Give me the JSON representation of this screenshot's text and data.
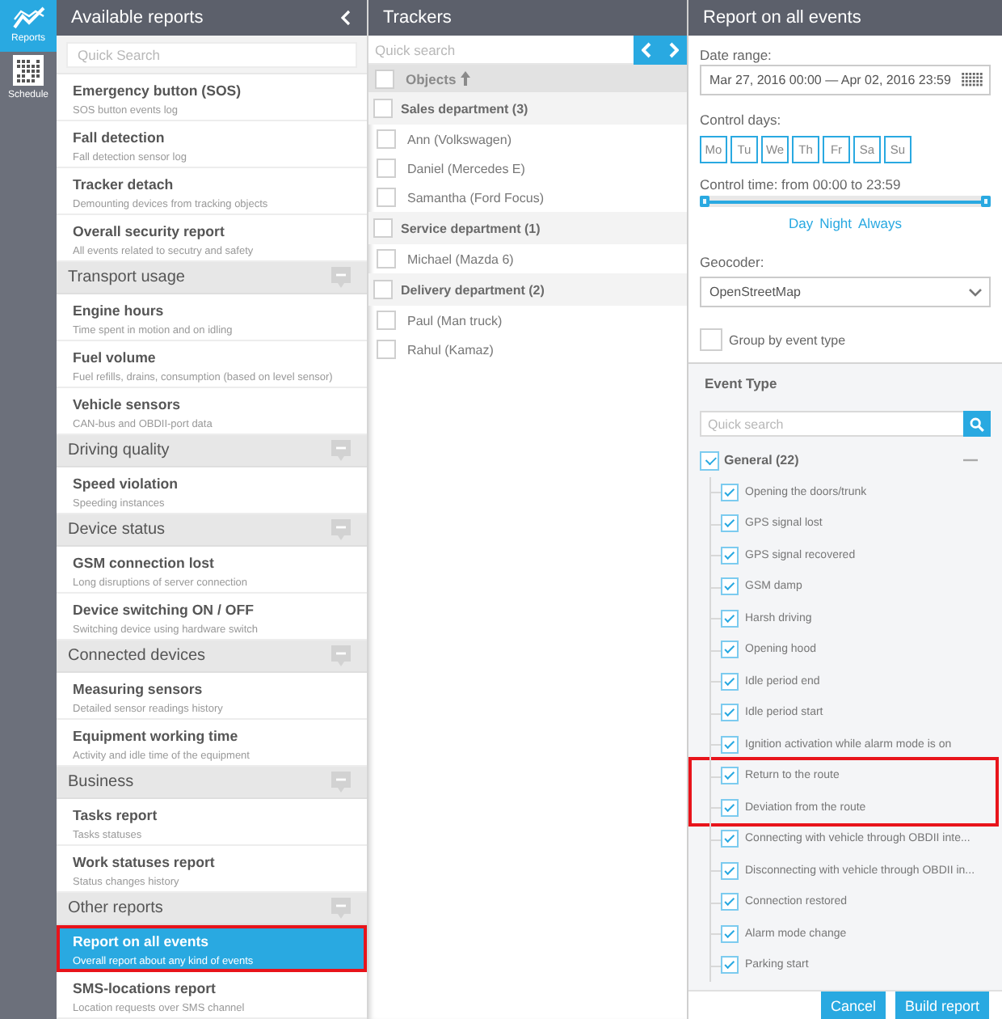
{
  "nav_rail": {
    "items": [
      {
        "label": "Reports",
        "selected": true
      },
      {
        "label": "Schedule",
        "selected": false
      }
    ]
  },
  "reports_panel": {
    "title": "Available reports",
    "search": {
      "placeholder": "Quick Search"
    },
    "entries": [
      {
        "kind": "report",
        "title": "Emergency button (SOS)",
        "description": "SOS button events log",
        "selected": false,
        "highlighted": false
      },
      {
        "kind": "report",
        "title": "Fall detection",
        "description": "Fall detection sensor log",
        "selected": false,
        "highlighted": false
      },
      {
        "kind": "report",
        "title": "Tracker detach",
        "description": "Demounting devices from tracking objects",
        "selected": false,
        "highlighted": false
      },
      {
        "kind": "report",
        "title": "Overall security report",
        "description": "All events related to secutry and safety",
        "selected": false,
        "highlighted": false
      },
      {
        "kind": "section",
        "title": "Transport usage",
        "expanded": true
      },
      {
        "kind": "report",
        "title": "Engine hours",
        "description": "Time spent in motion and on idling",
        "selected": false,
        "highlighted": false
      },
      {
        "kind": "report",
        "title": "Fuel volume",
        "description": "Fuel refills, drains, consumption (based on level sensor)",
        "selected": false,
        "highlighted": false
      },
      {
        "kind": "report",
        "title": "Vehicle sensors",
        "description": "CAN-bus and OBDII-port data",
        "selected": false,
        "highlighted": false
      },
      {
        "kind": "section",
        "title": "Driving quality",
        "expanded": true
      },
      {
        "kind": "report",
        "title": "Speed violation",
        "description": "Speeding instances",
        "selected": false,
        "highlighted": false
      },
      {
        "kind": "section",
        "title": "Device status",
        "expanded": true
      },
      {
        "kind": "report",
        "title": "GSM connection lost",
        "description": "Long disruptions of server connection",
        "selected": false,
        "highlighted": false
      },
      {
        "kind": "report",
        "title": "Device switching ON / OFF",
        "description": "Switching device using hardware switch",
        "selected": false,
        "highlighted": false
      },
      {
        "kind": "section",
        "title": "Connected devices",
        "expanded": true
      },
      {
        "kind": "report",
        "title": "Measuring sensors",
        "description": "Detailed sensor readings history",
        "selected": false,
        "highlighted": false
      },
      {
        "kind": "report",
        "title": "Equipment working time",
        "description": "Activity and idle time of the equipment",
        "selected": false,
        "highlighted": false
      },
      {
        "kind": "section",
        "title": "Business",
        "expanded": true
      },
      {
        "kind": "report",
        "title": "Tasks report",
        "description": "Tasks statuses",
        "selected": false,
        "highlighted": false
      },
      {
        "kind": "report",
        "title": "Work statuses report",
        "description": "Status changes history",
        "selected": false,
        "highlighted": false
      },
      {
        "kind": "section",
        "title": "Other reports",
        "expanded": true
      },
      {
        "kind": "report",
        "title": "Report on all events",
        "description": "Overall report about any kind of events",
        "selected": true,
        "highlighted": true
      },
      {
        "kind": "report",
        "title": "SMS-locations report",
        "description": "Location requests over SMS channel",
        "selected": false,
        "highlighted": false
      }
    ]
  },
  "trackers_panel": {
    "title": "Trackers",
    "search": {
      "placeholder": "Quick search"
    },
    "header": {
      "label": "Objects",
      "checked": false,
      "sorted_ascending": true
    },
    "groups": [
      {
        "name": "Sales department (3)",
        "checked": false,
        "trackers": [
          {
            "name": "Ann (Volkswagen)",
            "checked": false
          },
          {
            "name": "Daniel (Mercedes E)",
            "checked": false
          },
          {
            "name": "Samantha (Ford Focus)",
            "checked": false
          }
        ]
      },
      {
        "name": "Service department (1)",
        "checked": false,
        "trackers": [
          {
            "name": "Michael (Mazda 6)",
            "checked": false
          }
        ]
      },
      {
        "name": "Delivery department (2)",
        "checked": false,
        "trackers": [
          {
            "name": "Paul (Man truck)",
            "checked": false
          },
          {
            "name": "Rahul (Kamaz)",
            "checked": false
          }
        ]
      }
    ]
  },
  "report_settings": {
    "title": "Report on all events",
    "date_range": {
      "label": "Date range:",
      "value": "Mar 27, 2016 00:00 — Apr 02, 2016 23:59"
    },
    "control_days": {
      "label": "Control days:",
      "days": [
        {
          "label": "Mo",
          "selected": true
        },
        {
          "label": "Tu",
          "selected": true
        },
        {
          "label": "We",
          "selected": true
        },
        {
          "label": "Th",
          "selected": true
        },
        {
          "label": "Fr",
          "selected": true
        },
        {
          "label": "Sa",
          "selected": true
        },
        {
          "label": "Su",
          "selected": true
        }
      ]
    },
    "control_time": {
      "label": "Control time: from 00:00 to 23:59",
      "handles": [
        {
          "level": 0
        },
        {
          "level": 1
        }
      ],
      "presets": [
        "Day",
        "Night",
        "Always"
      ]
    },
    "geocoder": {
      "label": "Geocoder:",
      "value": "OpenStreetMap"
    },
    "group_by_event_type": {
      "label": "Group by event type",
      "checked": false
    },
    "event_type": {
      "title": "Event Type",
      "search": {
        "placeholder": "Quick search"
      },
      "groups": [
        {
          "name": "General (22)",
          "checked": true,
          "expanded": true,
          "events": [
            {
              "name": "Opening the doors/trunk",
              "checked": true,
              "highlighted": false
            },
            {
              "name": "GPS signal lost",
              "checked": true,
              "highlighted": false
            },
            {
              "name": "GPS signal recovered",
              "checked": true,
              "highlighted": false
            },
            {
              "name": "GSM damp",
              "checked": true,
              "highlighted": false
            },
            {
              "name": "Harsh driving",
              "checked": true,
              "highlighted": false
            },
            {
              "name": "Opening hood",
              "checked": true,
              "highlighted": false
            },
            {
              "name": "Idle period end",
              "checked": true,
              "highlighted": false
            },
            {
              "name": "Idle period start",
              "checked": true,
              "highlighted": false
            },
            {
              "name": "Ignition activation while alarm mode is on",
              "checked": true,
              "highlighted": false
            },
            {
              "name": "Return to the route",
              "checked": true,
              "highlighted": true
            },
            {
              "name": "Deviation from the route",
              "checked": true,
              "highlighted": true
            },
            {
              "name": "Connecting with vehicle through OBDII inte...",
              "checked": true,
              "highlighted": false
            },
            {
              "name": "Disconnecting with vehicle through OBDII in...",
              "checked": true,
              "highlighted": false
            },
            {
              "name": "Connection restored",
              "checked": true,
              "highlighted": false
            },
            {
              "name": "Alarm mode change",
              "checked": true,
              "highlighted": false
            },
            {
              "name": "Parking start",
              "checked": true,
              "highlighted": false
            }
          ]
        }
      ]
    },
    "buttons": [
      "Cancel",
      "Build report"
    ]
  }
}
